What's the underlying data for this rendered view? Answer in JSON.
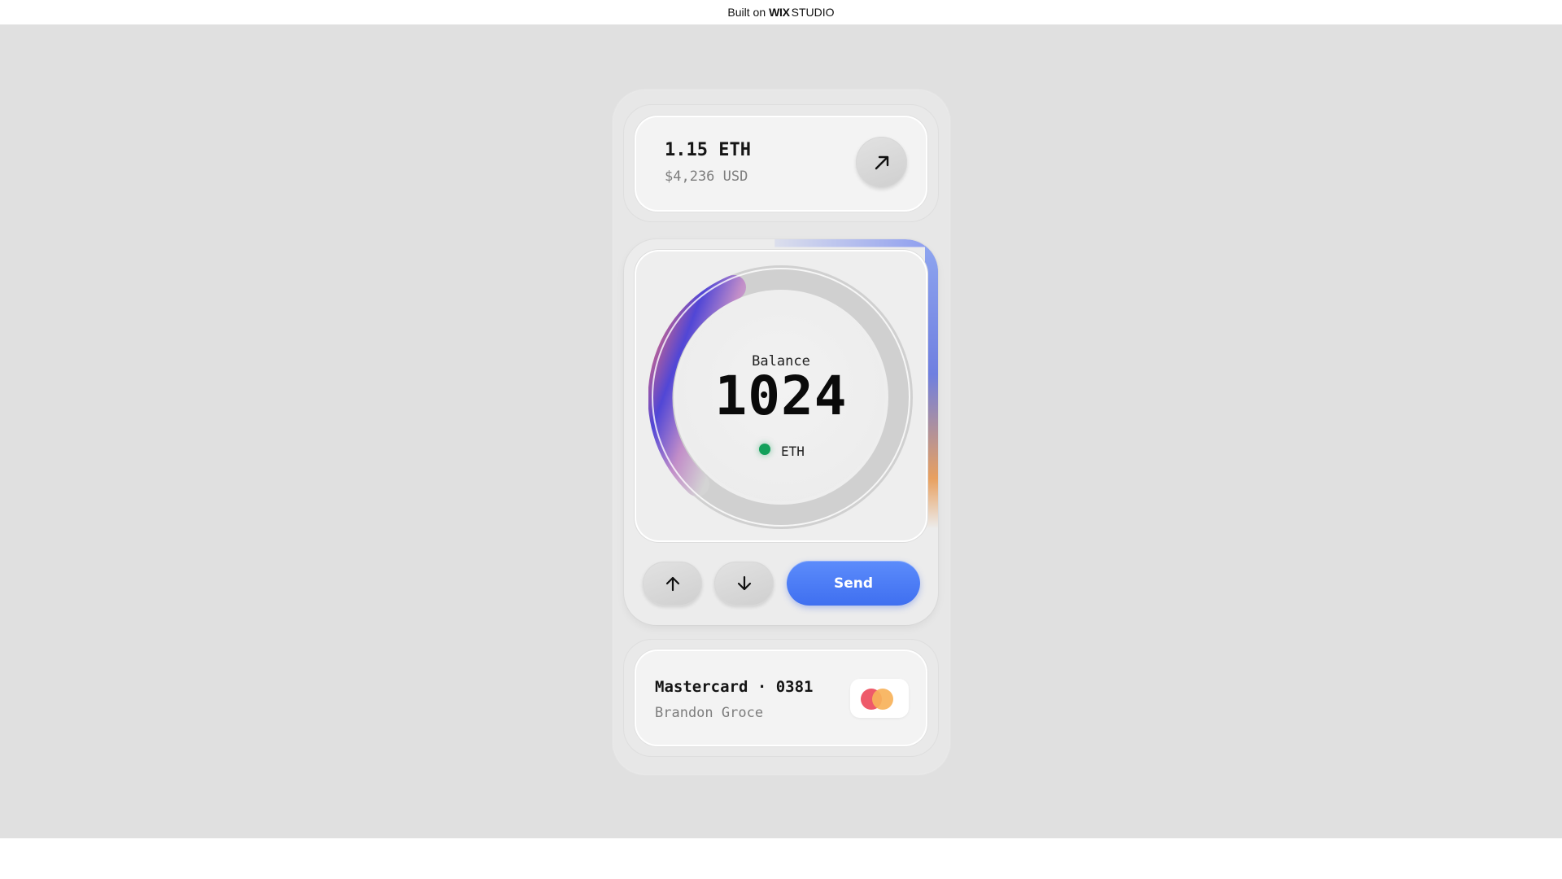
{
  "banner": {
    "prefix": "Built on",
    "brand_bold": "WIX",
    "brand_light": "STUDIO"
  },
  "account": {
    "eth_amount": "1.15 ETH",
    "usd_amount": "$4,236 USD",
    "open_icon": "arrow-up-right-icon"
  },
  "balance": {
    "label": "Balance",
    "value": "1024",
    "currency": "ETH",
    "status_color": "#12a05a"
  },
  "actions": {
    "up_icon": "arrow-up-icon",
    "down_icon": "arrow-down-icon",
    "send_label": "Send"
  },
  "card": {
    "title": "Mastercard · 0381",
    "holder": "Brandon Groce",
    "logo": "mastercard-logo"
  },
  "colors": {
    "accent": "#4a7cf5",
    "background": "#e0e0e0"
  }
}
